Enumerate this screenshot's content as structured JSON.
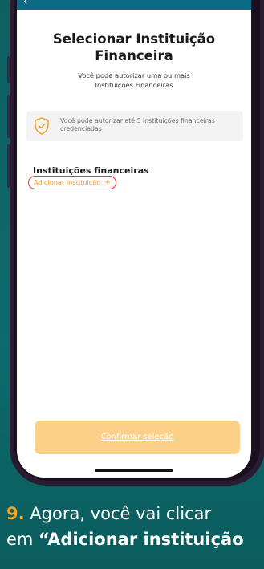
{
  "screen": {
    "title_line1": "Selecionar Instituição",
    "title_line2": "Financeira",
    "subtitle_line1": "Você pode autorizar uma ou mais",
    "subtitle_line2": "Instituições Financeiras",
    "info_text": "Você pode autorizar até 5 instituições financeiras credenciadas",
    "section_title": "Instituições financeiras",
    "add_label": "Adicionar instituição",
    "add_plus": "+",
    "confirm_label": "Confirmar seleção",
    "back_icon": "chevron-left-icon",
    "info_icon": "shield-check-icon"
  },
  "caption": {
    "step": "9.",
    "line1": " Agora, você vai clicar",
    "line2_prefix": "em ",
    "line2_strong": "“Adicionar instituição"
  },
  "colors": {
    "background": "#0f5f60",
    "accent": "#f29b16",
    "highlight": "#e23a2f",
    "button": "#fdd08a"
  }
}
